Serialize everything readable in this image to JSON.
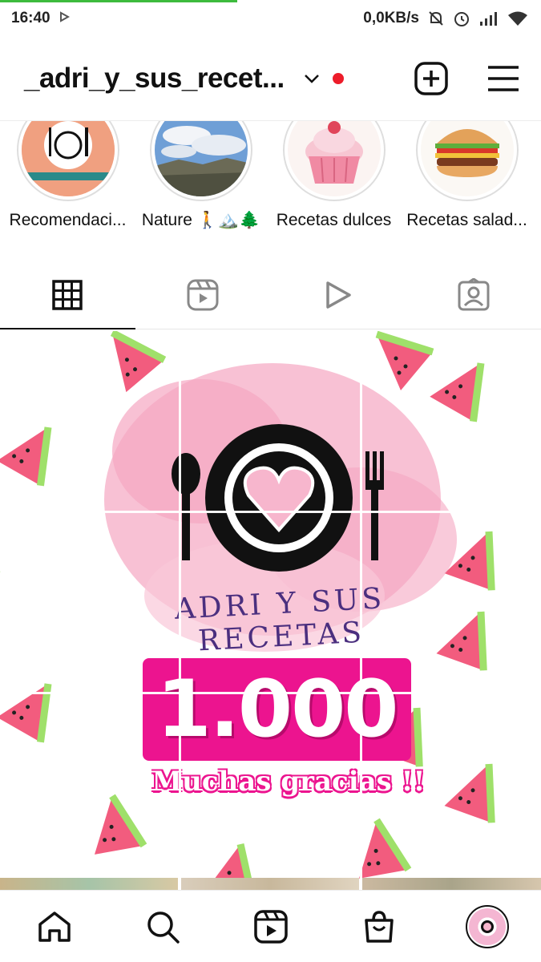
{
  "status": {
    "time": "16:40",
    "net_speed": "0,0KB/s",
    "icons": [
      "play-notification-icon",
      "mute-icon",
      "alarm-icon",
      "signal-icon",
      "wifi-icon"
    ]
  },
  "header": {
    "username": "_adri_y_sus_recet...",
    "icons": [
      "chevron-down-icon",
      "new-post-icon",
      "menu-icon"
    ],
    "notification_dot_color": "#ed1c2a"
  },
  "highlights": [
    {
      "label": "Recomendaci...",
      "icon": "restaurant-plate-icon"
    },
    {
      "label": "Nature 🚶🏔️🌲",
      "icon": "landscape-photo"
    },
    {
      "label": "Recetas dulces",
      "icon": "cupcake-image"
    },
    {
      "label": "Recetas salad...",
      "icon": "burger-image"
    }
  ],
  "tabs": [
    {
      "name": "grid",
      "icon": "grid-icon",
      "active": true
    },
    {
      "name": "reels",
      "icon": "reels-icon",
      "active": false
    },
    {
      "name": "videos",
      "icon": "play-icon",
      "active": false
    },
    {
      "name": "tagged",
      "icon": "tagged-person-icon",
      "active": false
    }
  ],
  "post": {
    "brand_text": "ADRI Y SUS RECETAS",
    "milestone": "1.000",
    "thanks": "Muchas gracias !!",
    "accent_color": "#ec148f"
  },
  "navbar": {
    "items": [
      "home-icon",
      "search-icon",
      "reels-icon",
      "shop-icon",
      "profile-avatar"
    ]
  }
}
